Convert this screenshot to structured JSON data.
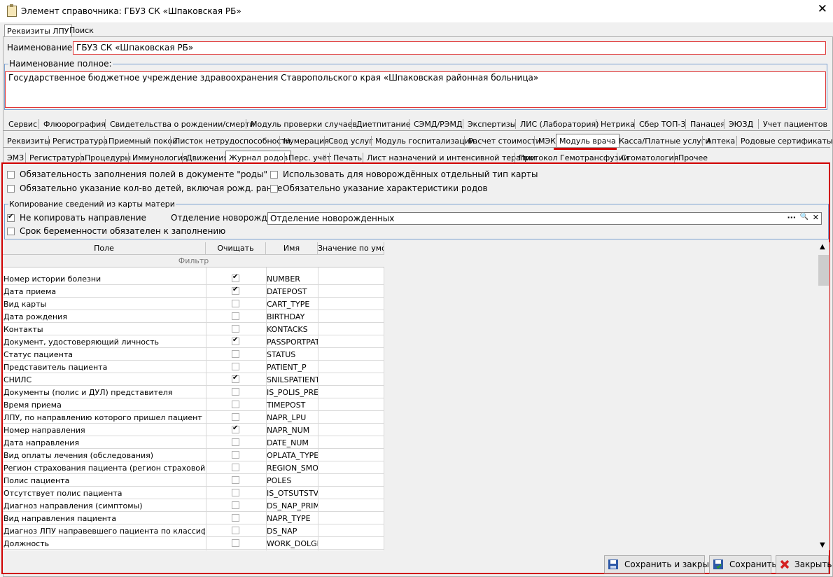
{
  "window": {
    "title": "Элемент справочника: ГБУЗ СК «Шпаковская РБ»",
    "close": "✕"
  },
  "outer_tabs": [
    "Реквизиты ЛПУ",
    "Поиск"
  ],
  "name_label": "Наименование:",
  "name_value": "ГБУЗ СК «Шпаковская РБ»",
  "fullname_label": "Наименование полное:",
  "fullname_value": "Государственное бюджетное учреждение здравоохранения Ставропольского края «Шпаковская районная больница»",
  "tabs_row1": [
    "Сервис",
    "Флюорография",
    "Свидетельства о рождении/смерти",
    "Модуль проверки случаев",
    "Диетпитание",
    "СЭМД/РЭМД",
    "Экспертизы",
    "ЛИС (Лаборатория)",
    "Нетрика",
    "Сбер ТОП-3",
    "Панацея",
    "ЭЮЗД",
    "Учет пациентов"
  ],
  "tabs_row2": [
    "Реквизиты",
    "Регистратура",
    "Приемный покой",
    "Листок нетрудоспособности",
    "Нумерация",
    "Свод услуг",
    "Модуль госпитализации",
    "Расчет стоимости",
    "МЭК",
    "Модуль врача",
    "Касса/Платные услуги",
    "Аптека",
    "Родовые сертификаты"
  ],
  "tabs_row3": [
    "ЭМЗ",
    "Регистратура",
    "Процедуры",
    "Иммунология",
    "Движения",
    "Журнал родов",
    "Перс. учёт",
    "Печать",
    "Лист назначений и интенсивной терапии",
    "Протокол Гемотрансфузии",
    "Стоматология",
    "Прочее"
  ],
  "options": {
    "opt1": "Обязательность заполнения полей в документе \"роды\"",
    "opt2": "Обязательно указание кол-во детей, включая рожд. ранее",
    "opt3": "Использовать для новорождённых отдельный тип карты",
    "opt4": "Обязательно указание характеристики родов"
  },
  "copy_group": {
    "title": "Копирование сведений из карты матери",
    "no_copy_label": "Не копировать направление",
    "dept_label": "Отделение новорожденных:",
    "dept_value": "Отделение новорожденных",
    "term_label": "Срок беременности обязателен к заполнению",
    "dots": "···",
    "search": "🔍",
    "clear": "✕"
  },
  "grid": {
    "headers": [
      "Поле",
      "Очищать",
      "Имя",
      "Значение по умол"
    ],
    "filter": "Фильтр",
    "rows": [
      {
        "field": "Номер истории болезни",
        "clear": true,
        "name": "NUMBER"
      },
      {
        "field": "Дата приема",
        "clear": true,
        "name": "DATEPOST"
      },
      {
        "field": "Вид карты",
        "clear": false,
        "name": "CART_TYPE"
      },
      {
        "field": "Дата рождения",
        "clear": false,
        "name": "BIRTHDAY"
      },
      {
        "field": "Контакты",
        "clear": false,
        "name": "KONTACKS"
      },
      {
        "field": "Документ, удостоверяющий личность",
        "clear": true,
        "name": "PASSPORTPAT"
      },
      {
        "field": "Статус пациента",
        "clear": false,
        "name": "STATUS"
      },
      {
        "field": "Представитель пациента",
        "clear": false,
        "name": "PATIENT_P"
      },
      {
        "field": "СНИЛС",
        "clear": true,
        "name": "SNILSPATIENT"
      },
      {
        "field": "Документы (полис и ДУЛ) представителя",
        "clear": false,
        "name": "IS_POLIS_PRE"
      },
      {
        "field": "Время приема",
        "clear": false,
        "name": "TIMEPOST"
      },
      {
        "field": "ЛПУ, по направлению которого пришел пациент",
        "clear": false,
        "name": "NAPR_LPU"
      },
      {
        "field": "Номер направления",
        "clear": true,
        "name": "NAPR_NUM"
      },
      {
        "field": "Дата направления",
        "clear": false,
        "name": "DATE_NUM"
      },
      {
        "field": "Вид оплаты лечения (обследования)",
        "clear": false,
        "name": "OPLATA_TYPE"
      },
      {
        "field": "Регион страхования пациента (регион страховой компа",
        "clear": false,
        "name": "REGION_SMO"
      },
      {
        "field": "Полис пациента",
        "clear": false,
        "name": "POLES"
      },
      {
        "field": "Отсутствует полис пациента",
        "clear": false,
        "name": "IS_OTSUTSTVU"
      },
      {
        "field": "Диагноз направления (симптомы)",
        "clear": false,
        "name": "DS_NAP_PRIM"
      },
      {
        "field": "Вид направления пациента",
        "clear": false,
        "name": "NAPR_TYPE"
      },
      {
        "field": "Диагноз ЛПУ направевшего пациента по классификатор",
        "clear": false,
        "name": "DS_NAP"
      },
      {
        "field": "Должность",
        "clear": false,
        "name": "WORK_DOLGN"
      }
    ]
  },
  "buttons": {
    "save_close": "Сохранить и закрыть",
    "save": "Сохранить",
    "close": "Закрыть"
  },
  "colors": {
    "highlight": "#d00000"
  }
}
